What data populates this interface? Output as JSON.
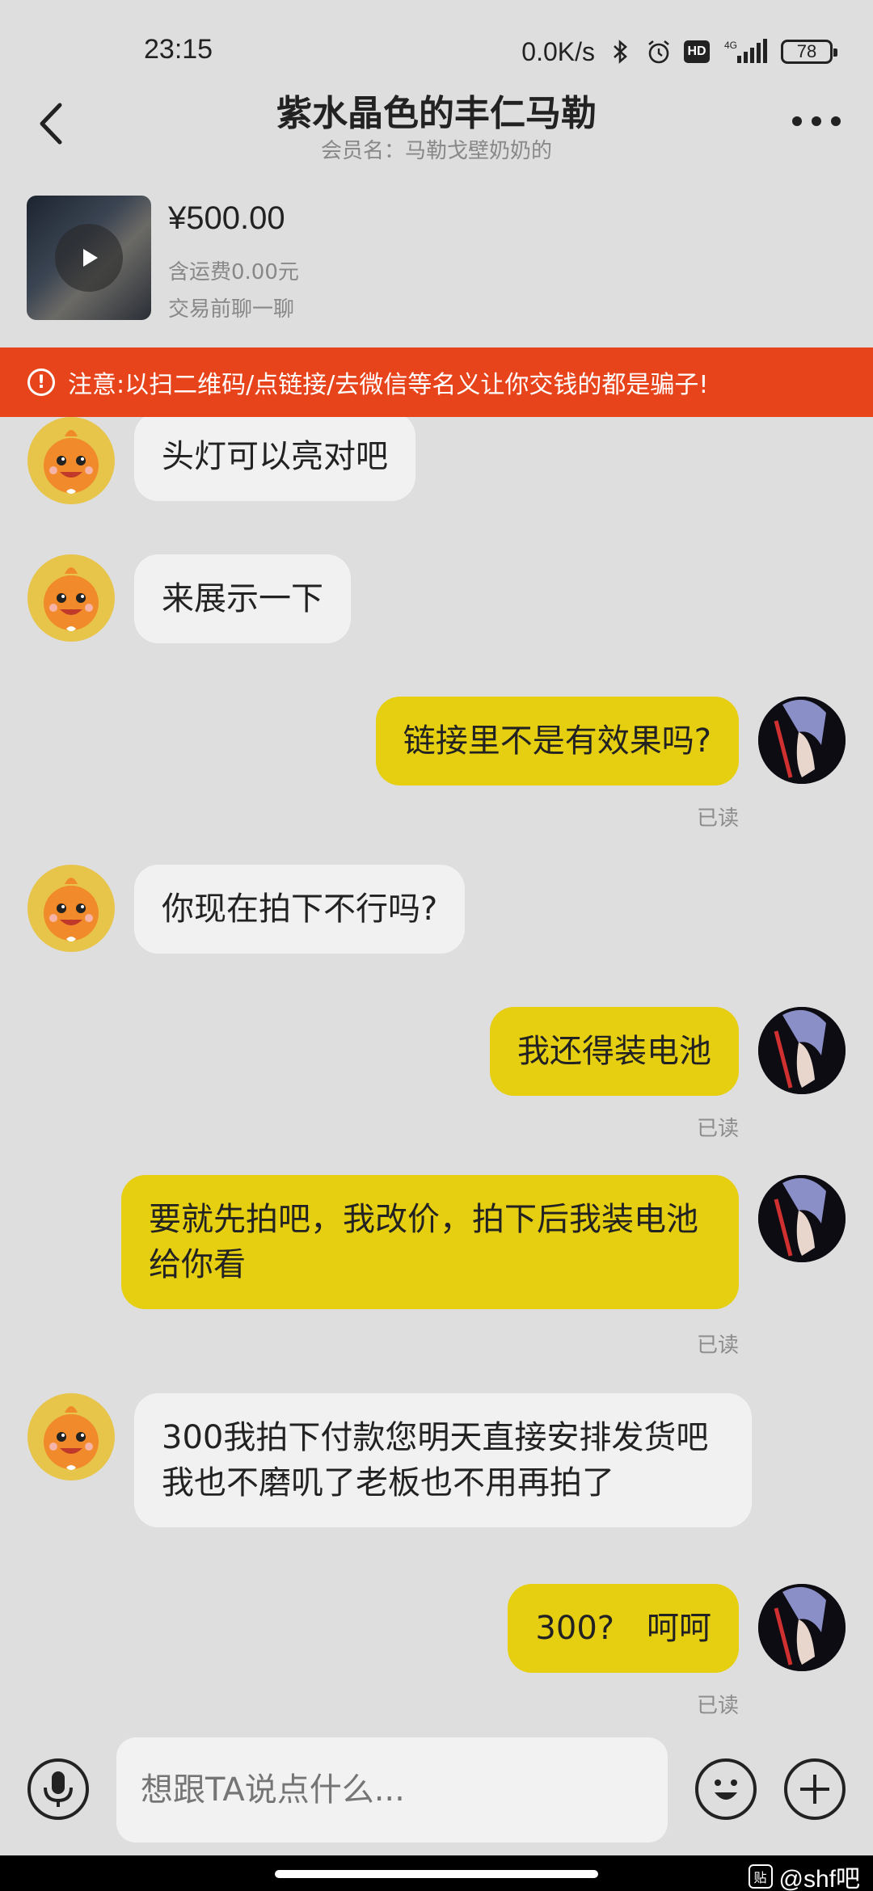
{
  "status_bar": {
    "time": "23:15",
    "net_speed": "0.0K/s",
    "battery": "78",
    "hd_label": "HD",
    "net_type": "4G"
  },
  "header": {
    "title": "紫水晶色的丰仁马勒",
    "subtitle": "会员名：马勒戈壁奶奶的"
  },
  "product": {
    "price": "¥500.00",
    "shipping": "含运费0.00元",
    "prechat": "交易前聊一聊"
  },
  "warning": {
    "text": "注意:以扫二维码/点链接/去微信等名义让你交钱的都是骗子!"
  },
  "messages": [
    {
      "side": "left",
      "text": "头灯可以亮对吧"
    },
    {
      "side": "left",
      "text": "来展示一下"
    },
    {
      "side": "right",
      "text": "链接里不是有效果吗?",
      "status": "已读"
    },
    {
      "side": "left",
      "text": "你现在拍下不行吗?"
    },
    {
      "side": "right",
      "text": "我还得装电池",
      "status": "已读"
    },
    {
      "side": "right",
      "text": "要就先拍吧，我改价，拍下后我装电池给你看",
      "status": "已读"
    },
    {
      "side": "left",
      "text": "300我拍下付款您明天直接安排发货吧我也不磨叽了老板也不用再拍了"
    },
    {
      "side": "right",
      "text": "300?　呵呵",
      "status": "已读"
    }
  ],
  "composer": {
    "placeholder": "想跟TA说点什么..."
  },
  "watermark": {
    "logo": "贴",
    "text": "@shf吧"
  },
  "icons": {
    "back": "chevron-left-icon",
    "more": "more-dots-icon",
    "mic": "microphone-icon",
    "emoji": "smiley-icon",
    "plus": "plus-icon",
    "warning": "exclamation-circle-icon"
  },
  "colors": {
    "accent_yellow": "#e6cf10",
    "warning_red": "#e8441c",
    "background": "#dedede"
  }
}
